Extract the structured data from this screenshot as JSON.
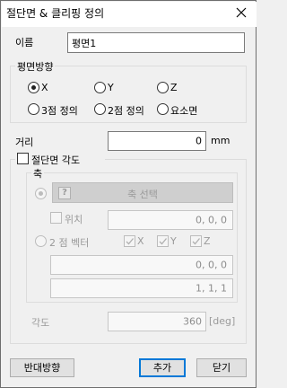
{
  "window": {
    "title": "절단면 & 클리핑 정의"
  },
  "name": {
    "label": "이름",
    "value": "평면1"
  },
  "plane_direction": {
    "group_label": "평면방향",
    "options": [
      "X",
      "Y",
      "Z",
      "3점 정의",
      "2점 정의",
      "요소면"
    ],
    "selected": "X"
  },
  "distance": {
    "label": "거리",
    "value": "0",
    "unit": "mm"
  },
  "section_angle": {
    "checkbox_label": "절단면 각도",
    "axis_group_label": "축",
    "axis_select_label": "축 선택",
    "position_label": "위치",
    "position_value": "0, 0, 0",
    "two_point_vector_label": "2 점 벡터",
    "vector_checks": [
      "X",
      "Y",
      "Z"
    ],
    "vector_point1": "0, 0, 0",
    "vector_point2": "1, 1, 1",
    "angle_label": "각도",
    "angle_value": "360",
    "angle_unit": "[deg]"
  },
  "buttons": {
    "reverse": "반대방향",
    "add": "추가",
    "close": "닫기"
  }
}
